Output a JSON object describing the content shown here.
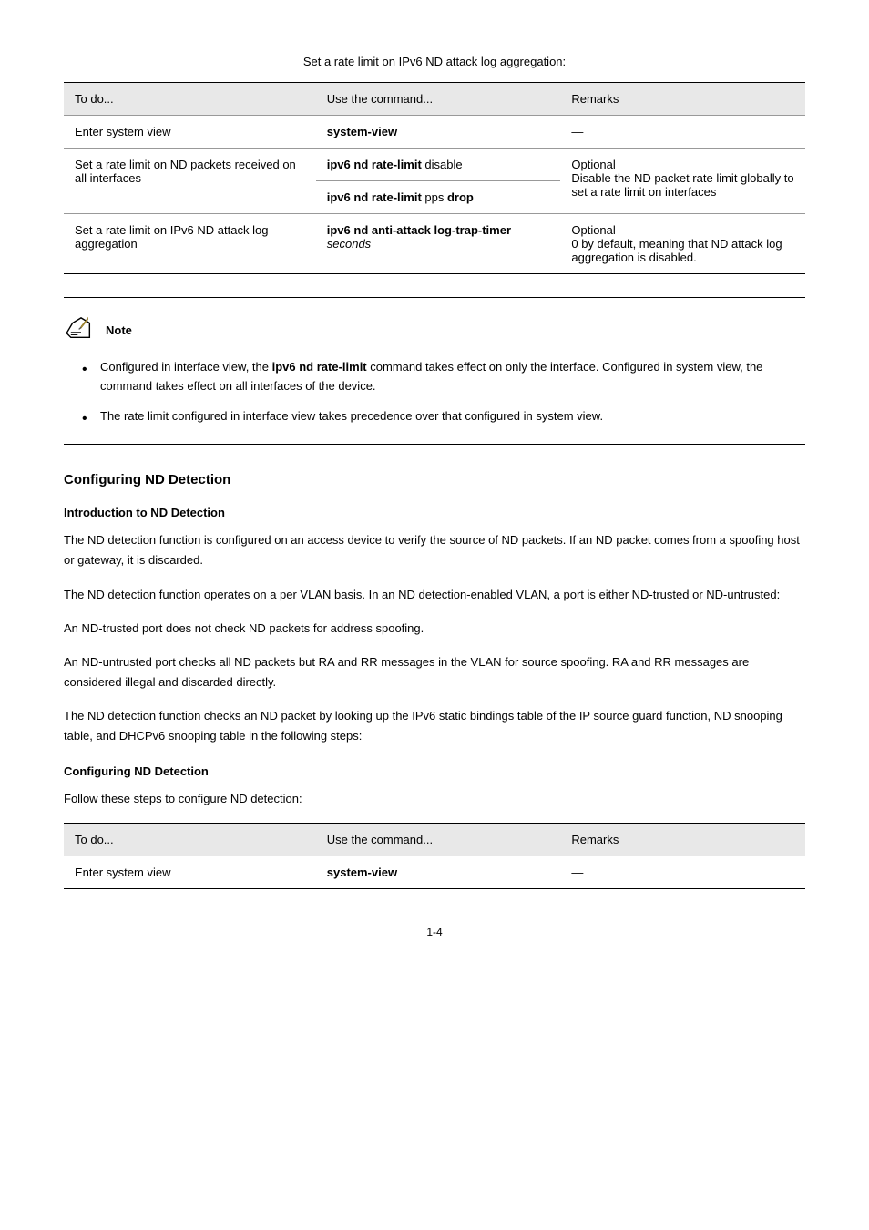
{
  "table1": {
    "caption": "Set a rate limit on IPv6 ND attack log aggregation:",
    "headers": [
      "To do...",
      "Use the command...",
      "Remarks"
    ],
    "rows": [
      {
        "col1": "Enter system view",
        "col2_html": "<span class='bold'>system-view</span>",
        "col3": "—"
      },
      {
        "col1_span2": "Set a rate limit on ND packets received on all interfaces",
        "col2a_html": "<span class='bold'>ipv6 nd rate-limit</span> disable",
        "col2b_html": "<span class='bold'>ipv6 nd rate-limit</span> pps <span class='bold'>drop</span>",
        "col3_span2": "Optional\nDisable the ND packet rate limit globally to set a rate limit on interfaces"
      },
      {
        "col1": "Set a rate limit on IPv6 ND attack log aggregation",
        "col2_html": "<span class='bold'>ipv6 nd anti-attack log-trap-timer</span> <span class='italic'>seconds</span>",
        "col3": "Optional\n0 by default, meaning that ND attack log aggregation is disabled."
      }
    ]
  },
  "note": {
    "label": "Note",
    "bullets": [
      {
        "html": "Configured in interface view, the <span class='bold'>ipv6 nd rate-limit</span> command takes effect on only the interface. Configured in system view, the command takes effect on all interfaces of the device."
      },
      {
        "html": "The rate limit configured in interface view takes precedence over that configured in system view."
      }
    ]
  },
  "section": {
    "heading": "Configuring ND Detection",
    "intro": "Introduction to ND Detection",
    "p1_html": "The ND detection function is configured on an access device to verify the source of ND packets. If an ND packet comes from a spoofing host or gateway, it is discarded.",
    "p2_html": "The ND detection function operates on a per VLAN basis. In an ND detection-enabled VLAN, a port is either ND-trusted or ND-untrusted:",
    "p3_html": "An ND-trusted port does not check ND packets for address spoofing.",
    "p4_html": "An ND-untrusted port checks all ND packets but RA and RR messages in the VLAN for source spoofing. RA and RR messages are considered illegal and discarded directly.",
    "p5_html": "The ND detection function checks an ND packet by looking up the IPv6 static bindings table of the IP source guard function, ND snooping table, and DHCPv6 snooping table in the following steps:",
    "configuring": "Configuring ND Detection",
    "follow": "Follow these steps to configure ND detection:"
  },
  "table2": {
    "headers": [
      "To do...",
      "Use the command...",
      "Remarks"
    ],
    "rows": [
      {
        "col1": "Enter system view",
        "col2_html": "<span class='bold'>system-view</span>",
        "col3": "—"
      }
    ]
  },
  "page_number": "1-4"
}
